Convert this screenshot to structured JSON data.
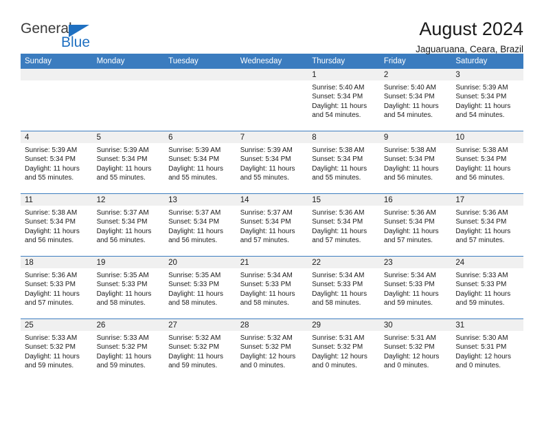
{
  "brand": {
    "name_top": "General",
    "name_bottom": "Blue",
    "triangle_color": "#1f70c1",
    "text_color": "#3b3b3b"
  },
  "header": {
    "title": "August 2024",
    "subtitle": "Jaguaruana, Ceara, Brazil"
  },
  "theme": {
    "header_bg": "#3b7cbf",
    "header_text": "#ffffff",
    "daynum_band_bg": "#f0f0f0",
    "cell_bg": "#ffffff",
    "row_divider": "#3b7cbf"
  },
  "weekday_headers": [
    "Sunday",
    "Monday",
    "Tuesday",
    "Wednesday",
    "Thursday",
    "Friday",
    "Saturday"
  ],
  "labels": {
    "sunrise_prefix": "Sunrise:",
    "sunset_prefix": "Sunset:",
    "daylight_prefix": "Daylight:"
  },
  "weeks": [
    [
      {
        "day": "",
        "empty": true
      },
      {
        "day": "",
        "empty": true
      },
      {
        "day": "",
        "empty": true
      },
      {
        "day": "",
        "empty": true
      },
      {
        "day": "1",
        "sunrise": "Sunrise: 5:40 AM",
        "sunset": "Sunset: 5:34 PM",
        "daylight_line1": "Daylight: 11 hours",
        "daylight_line2": "and 54 minutes."
      },
      {
        "day": "2",
        "sunrise": "Sunrise: 5:40 AM",
        "sunset": "Sunset: 5:34 PM",
        "daylight_line1": "Daylight: 11 hours",
        "daylight_line2": "and 54 minutes."
      },
      {
        "day": "3",
        "sunrise": "Sunrise: 5:39 AM",
        "sunset": "Sunset: 5:34 PM",
        "daylight_line1": "Daylight: 11 hours",
        "daylight_line2": "and 54 minutes."
      }
    ],
    [
      {
        "day": "4",
        "sunrise": "Sunrise: 5:39 AM",
        "sunset": "Sunset: 5:34 PM",
        "daylight_line1": "Daylight: 11 hours",
        "daylight_line2": "and 55 minutes."
      },
      {
        "day": "5",
        "sunrise": "Sunrise: 5:39 AM",
        "sunset": "Sunset: 5:34 PM",
        "daylight_line1": "Daylight: 11 hours",
        "daylight_line2": "and 55 minutes."
      },
      {
        "day": "6",
        "sunrise": "Sunrise: 5:39 AM",
        "sunset": "Sunset: 5:34 PM",
        "daylight_line1": "Daylight: 11 hours",
        "daylight_line2": "and 55 minutes."
      },
      {
        "day": "7",
        "sunrise": "Sunrise: 5:39 AM",
        "sunset": "Sunset: 5:34 PM",
        "daylight_line1": "Daylight: 11 hours",
        "daylight_line2": "and 55 minutes."
      },
      {
        "day": "8",
        "sunrise": "Sunrise: 5:38 AM",
        "sunset": "Sunset: 5:34 PM",
        "daylight_line1": "Daylight: 11 hours",
        "daylight_line2": "and 55 minutes."
      },
      {
        "day": "9",
        "sunrise": "Sunrise: 5:38 AM",
        "sunset": "Sunset: 5:34 PM",
        "daylight_line1": "Daylight: 11 hours",
        "daylight_line2": "and 56 minutes."
      },
      {
        "day": "10",
        "sunrise": "Sunrise: 5:38 AM",
        "sunset": "Sunset: 5:34 PM",
        "daylight_line1": "Daylight: 11 hours",
        "daylight_line2": "and 56 minutes."
      }
    ],
    [
      {
        "day": "11",
        "sunrise": "Sunrise: 5:38 AM",
        "sunset": "Sunset: 5:34 PM",
        "daylight_line1": "Daylight: 11 hours",
        "daylight_line2": "and 56 minutes."
      },
      {
        "day": "12",
        "sunrise": "Sunrise: 5:37 AM",
        "sunset": "Sunset: 5:34 PM",
        "daylight_line1": "Daylight: 11 hours",
        "daylight_line2": "and 56 minutes."
      },
      {
        "day": "13",
        "sunrise": "Sunrise: 5:37 AM",
        "sunset": "Sunset: 5:34 PM",
        "daylight_line1": "Daylight: 11 hours",
        "daylight_line2": "and 56 minutes."
      },
      {
        "day": "14",
        "sunrise": "Sunrise: 5:37 AM",
        "sunset": "Sunset: 5:34 PM",
        "daylight_line1": "Daylight: 11 hours",
        "daylight_line2": "and 57 minutes."
      },
      {
        "day": "15",
        "sunrise": "Sunrise: 5:36 AM",
        "sunset": "Sunset: 5:34 PM",
        "daylight_line1": "Daylight: 11 hours",
        "daylight_line2": "and 57 minutes."
      },
      {
        "day": "16",
        "sunrise": "Sunrise: 5:36 AM",
        "sunset": "Sunset: 5:34 PM",
        "daylight_line1": "Daylight: 11 hours",
        "daylight_line2": "and 57 minutes."
      },
      {
        "day": "17",
        "sunrise": "Sunrise: 5:36 AM",
        "sunset": "Sunset: 5:34 PM",
        "daylight_line1": "Daylight: 11 hours",
        "daylight_line2": "and 57 minutes."
      }
    ],
    [
      {
        "day": "18",
        "sunrise": "Sunrise: 5:36 AM",
        "sunset": "Sunset: 5:33 PM",
        "daylight_line1": "Daylight: 11 hours",
        "daylight_line2": "and 57 minutes."
      },
      {
        "day": "19",
        "sunrise": "Sunrise: 5:35 AM",
        "sunset": "Sunset: 5:33 PM",
        "daylight_line1": "Daylight: 11 hours",
        "daylight_line2": "and 58 minutes."
      },
      {
        "day": "20",
        "sunrise": "Sunrise: 5:35 AM",
        "sunset": "Sunset: 5:33 PM",
        "daylight_line1": "Daylight: 11 hours",
        "daylight_line2": "and 58 minutes."
      },
      {
        "day": "21",
        "sunrise": "Sunrise: 5:34 AM",
        "sunset": "Sunset: 5:33 PM",
        "daylight_line1": "Daylight: 11 hours",
        "daylight_line2": "and 58 minutes."
      },
      {
        "day": "22",
        "sunrise": "Sunrise: 5:34 AM",
        "sunset": "Sunset: 5:33 PM",
        "daylight_line1": "Daylight: 11 hours",
        "daylight_line2": "and 58 minutes."
      },
      {
        "day": "23",
        "sunrise": "Sunrise: 5:34 AM",
        "sunset": "Sunset: 5:33 PM",
        "daylight_line1": "Daylight: 11 hours",
        "daylight_line2": "and 59 minutes."
      },
      {
        "day": "24",
        "sunrise": "Sunrise: 5:33 AM",
        "sunset": "Sunset: 5:33 PM",
        "daylight_line1": "Daylight: 11 hours",
        "daylight_line2": "and 59 minutes."
      }
    ],
    [
      {
        "day": "25",
        "sunrise": "Sunrise: 5:33 AM",
        "sunset": "Sunset: 5:32 PM",
        "daylight_line1": "Daylight: 11 hours",
        "daylight_line2": "and 59 minutes."
      },
      {
        "day": "26",
        "sunrise": "Sunrise: 5:33 AM",
        "sunset": "Sunset: 5:32 PM",
        "daylight_line1": "Daylight: 11 hours",
        "daylight_line2": "and 59 minutes."
      },
      {
        "day": "27",
        "sunrise": "Sunrise: 5:32 AM",
        "sunset": "Sunset: 5:32 PM",
        "daylight_line1": "Daylight: 11 hours",
        "daylight_line2": "and 59 minutes."
      },
      {
        "day": "28",
        "sunrise": "Sunrise: 5:32 AM",
        "sunset": "Sunset: 5:32 PM",
        "daylight_line1": "Daylight: 12 hours",
        "daylight_line2": "and 0 minutes."
      },
      {
        "day": "29",
        "sunrise": "Sunrise: 5:31 AM",
        "sunset": "Sunset: 5:32 PM",
        "daylight_line1": "Daylight: 12 hours",
        "daylight_line2": "and 0 minutes."
      },
      {
        "day": "30",
        "sunrise": "Sunrise: 5:31 AM",
        "sunset": "Sunset: 5:32 PM",
        "daylight_line1": "Daylight: 12 hours",
        "daylight_line2": "and 0 minutes."
      },
      {
        "day": "31",
        "sunrise": "Sunrise: 5:30 AM",
        "sunset": "Sunset: 5:31 PM",
        "daylight_line1": "Daylight: 12 hours",
        "daylight_line2": "and 0 minutes."
      }
    ]
  ]
}
